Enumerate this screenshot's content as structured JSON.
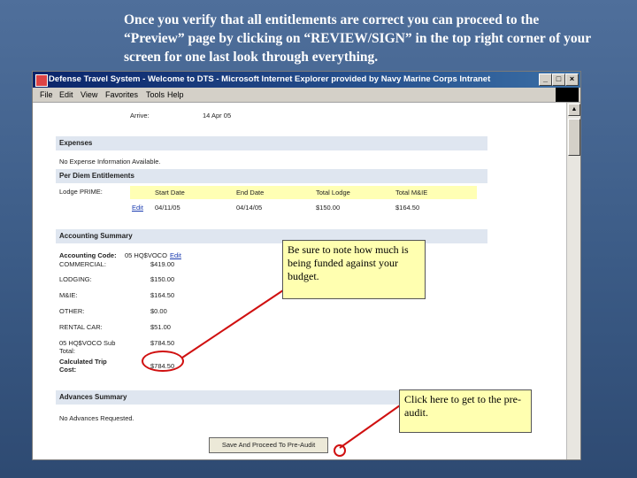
{
  "slide": {
    "instruction": "Once you verify that all entitlements are correct you can proceed to the “Preview” page by clicking on “REVIEW/SIGN” in the top right corner of your screen for one last look through everything."
  },
  "window": {
    "title": "Defense Travel System - Welcome to DTS - Microsoft Internet Explorer provided by Navy Marine Corps Intranet",
    "controls": [
      "_",
      "□",
      "×"
    ]
  },
  "menu": [
    "File",
    "Edit",
    "View",
    "Favorites",
    "Tools",
    "Help"
  ],
  "top_row": {
    "label": "Arrive:",
    "value": "14 Apr 05"
  },
  "expenses": {
    "header": "Expenses",
    "empty_text": "No Expense Information Available."
  },
  "per_diem": {
    "header": "Per Diem Entitlements",
    "row_label": "Lodge PRIME:",
    "columns": [
      "Start Date",
      "End Date",
      "Total Lodge",
      "Total M&IE"
    ],
    "edit_link": "Edit",
    "values": [
      "04/11/05",
      "04/14/05",
      "$150.00",
      "$164.50"
    ]
  },
  "accounting": {
    "header": "Accounting Summary",
    "code_label": "Accounting Code:",
    "code_value": "05 HQ$VOCO",
    "edit_link": "Edit",
    "rows": [
      {
        "label": "COMMERCIAL:",
        "value": "$419.00"
      },
      {
        "label": "LODGING:",
        "value": "$150.00"
      },
      {
        "label": "M&IE:",
        "value": "$164.50"
      },
      {
        "label": "OTHER:",
        "value": "$0.00"
      },
      {
        "label": "RENTAL CAR:",
        "value": "$51.00"
      },
      {
        "label": "05 HQ$VOCO Sub Total:",
        "value": "$784.50"
      }
    ],
    "calculated_label": "Calculated Trip Cost:",
    "calculated_value": "$784.50"
  },
  "advances": {
    "header": "Advances Summary",
    "empty_text": "No Advances Requested."
  },
  "proceed_button": "Save And Proceed To Pre-Audit",
  "callouts": {
    "budget": "Be sure to note how much is being funded against your budget.",
    "preaudit": "Click here to get to the pre- audit."
  },
  "colors": {
    "slide_bg": "#3b5b86",
    "callout_bg": "#ffffb0",
    "highlight": "#d01010",
    "section_bg": "#dfe6f0"
  }
}
